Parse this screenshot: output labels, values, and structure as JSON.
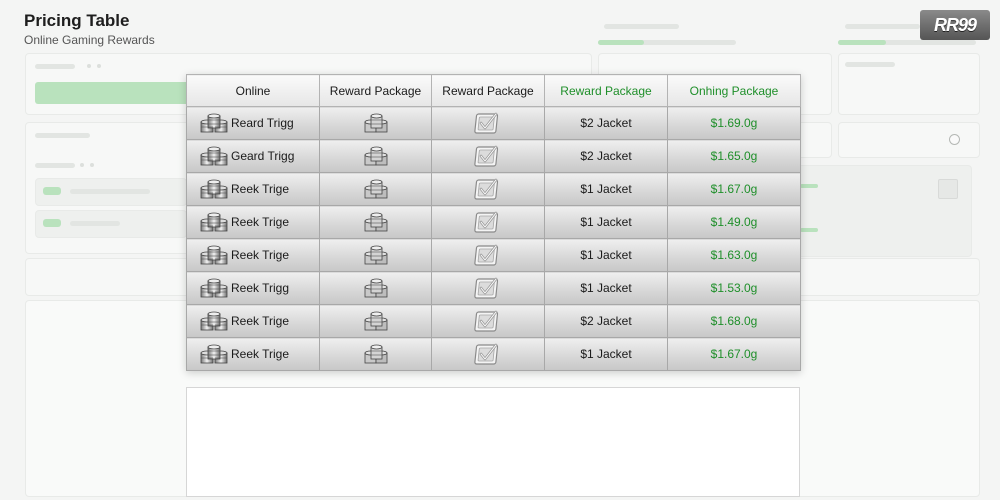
{
  "header": {
    "title": "Pricing Table",
    "subtitle": "Online Gaming Rewards"
  },
  "logo": {
    "text": "RR99"
  },
  "table": {
    "columns": [
      "Online",
      "Reward Package",
      "Reward Package",
      "Reward Package",
      "Onhing Package"
    ],
    "rows": [
      {
        "name": "Reard Trigg",
        "package": "$2 Jacket",
        "price": "$1.69.0g"
      },
      {
        "name": "Geard Trigg",
        "package": "$2 Jacket",
        "price": "$1.65.0g"
      },
      {
        "name": "Reek Trige",
        "package": "$1 Jacket",
        "price": "$1.67.0g"
      },
      {
        "name": "Reek Trige",
        "package": "$1 Jacket",
        "price": "$1.49.0g"
      },
      {
        "name": "Reek Trige",
        "package": "$1 Jacket",
        "price": "$1.63.0g"
      },
      {
        "name": "Reek Trigg",
        "package": "$1 Jacket",
        "price": "$1.53.0g"
      },
      {
        "name": "Reek Trige",
        "package": "$2 Jacket",
        "price": "$1.68.0g"
      },
      {
        "name": "Reek Trige",
        "package": "$1 Jacket",
        "price": "$1.67.0g"
      }
    ]
  },
  "icons": {
    "coins": "coin-stack-icon",
    "check": "checkbox-check-icon"
  },
  "colors": {
    "accent_green": "#1f8f2a",
    "table_header_bg": "#f0f0f0"
  }
}
